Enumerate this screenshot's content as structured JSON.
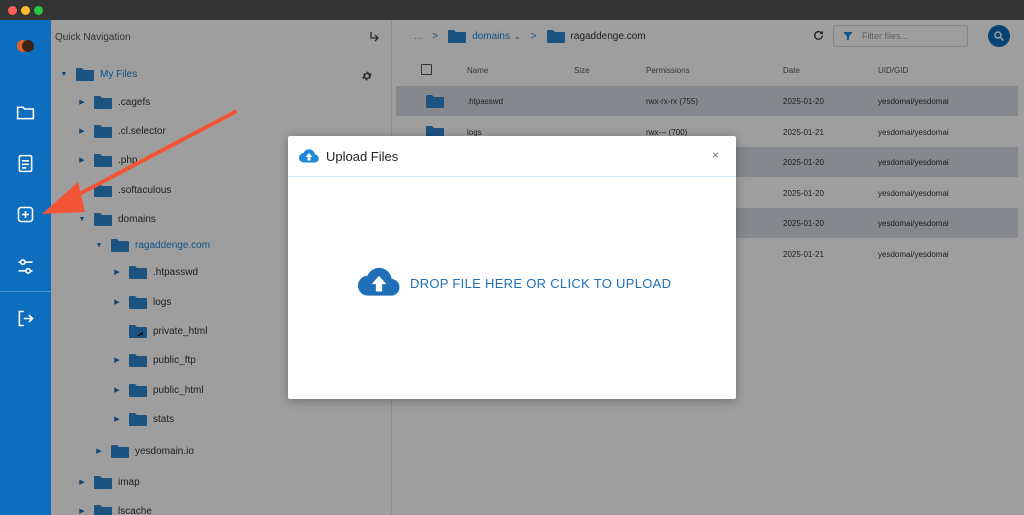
{
  "colors": {
    "accent": "#0d6dbf",
    "folder": "#2f86d1",
    "arrow": "#f25536"
  },
  "window": {
    "buttons": [
      "close",
      "minimize",
      "maximize"
    ]
  },
  "rail": {
    "items": [
      {
        "icon": "folder-icon"
      },
      {
        "icon": "document-icon"
      },
      {
        "icon": "plus-square-icon"
      },
      {
        "icon": "settings-sliders-icon"
      },
      {
        "icon": "logout-icon"
      }
    ]
  },
  "tree": {
    "header": "Quick Navigation",
    "items": [
      {
        "label": "My Files",
        "caret": "▼",
        "blue": true
      },
      {
        "label": ".cagefs",
        "caret": "▶"
      },
      {
        "label": ".cl.selector",
        "caret": "▶"
      },
      {
        "label": ".php",
        "caret": "▶"
      },
      {
        "label": ".softaculous",
        "caret": ""
      },
      {
        "label": "domains",
        "caret": "▼"
      },
      {
        "label": "ragaddenge.com",
        "caret": "▼",
        "blue": true
      },
      {
        "label": ".htpasswd",
        "caret": "▶"
      },
      {
        "label": "logs",
        "caret": "▶"
      },
      {
        "label": "private_html",
        "caret": ""
      },
      {
        "label": "public_ftp",
        "caret": "▶"
      },
      {
        "label": "public_html",
        "caret": "▶"
      },
      {
        "label": "stats",
        "caret": "▶"
      },
      {
        "label": "yesdomain.io",
        "caret": "▶"
      },
      {
        "label": "imap",
        "caret": "▶"
      },
      {
        "label": "lscache",
        "caret": "▶"
      }
    ]
  },
  "breadcrumb": {
    "ellipsis": "...",
    "separator": ">",
    "items": [
      {
        "label": "domains",
        "dropdown": "⌄"
      },
      {
        "label": "ragaddenge.com"
      }
    ]
  },
  "filter": {
    "placeholder": "Filter files..."
  },
  "table": {
    "columns": [
      "Name",
      "Size",
      "Permissions",
      "Date",
      "UID/GID"
    ],
    "rows": [
      {
        "name": ".htpasswd",
        "size": "",
        "perm": "rwx-rx-rx (755)",
        "date": "2025-01-20",
        "uid": "yesdomai/yesdomai"
      },
      {
        "name": "logs",
        "size": "",
        "perm": "rwx--- (700)",
        "date": "2025-01-21",
        "uid": "yesdomai/yesdomai"
      },
      {
        "name": "",
        "size": "",
        "perm": "",
        "date": "2025-01-20",
        "uid": "yesdomai/yesdomai"
      },
      {
        "name": "",
        "size": "",
        "perm": "",
        "date": "2025-01-20",
        "uid": "yesdomai/yesdomai"
      },
      {
        "name": "",
        "size": "",
        "perm": "",
        "date": "2025-01-20",
        "uid": "yesdomai/yesdomai"
      },
      {
        "name": "",
        "size": "",
        "perm": "",
        "date": "2025-01-21",
        "uid": "yesdomai/yesdomai"
      }
    ]
  },
  "modal": {
    "title": "Upload Files",
    "close": "×",
    "drop_text": "DROP FILE HERE OR CLICK TO UPLOAD"
  }
}
